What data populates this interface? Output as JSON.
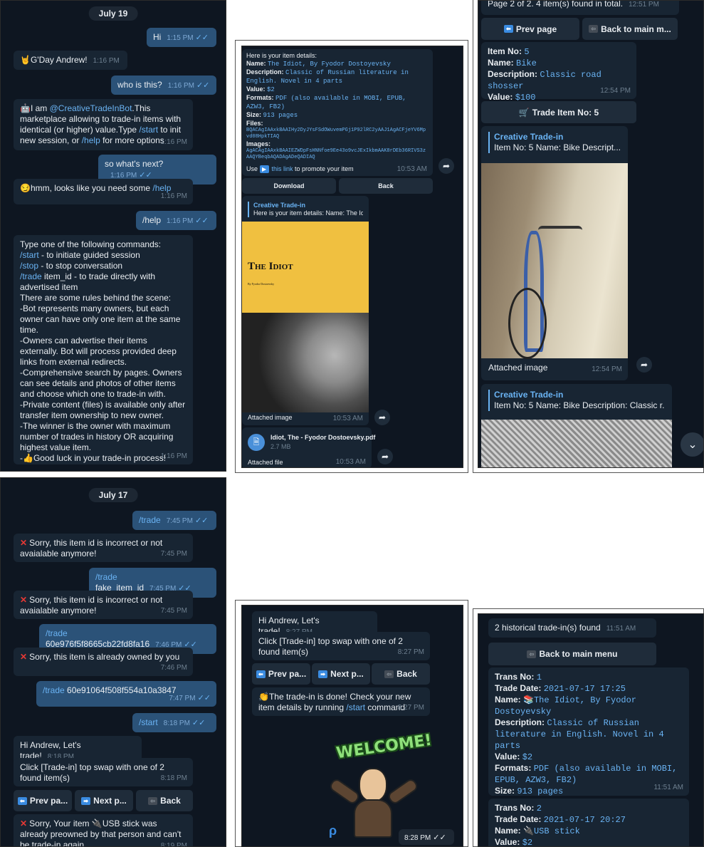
{
  "p1": {
    "date": "July 19",
    "m1": {
      "text": "Hi",
      "time": "1:15 PM"
    },
    "m2": {
      "text": "G'Day Andrew!",
      "time": "1:16 PM"
    },
    "m3": {
      "text": "who is this?",
      "time": "1:16 PM"
    },
    "m4": {
      "a": "I am ",
      "bot": "@CreativeTradeInBot",
      "b": ".This marketplace allowing to trade-in items with identical (or higher) value.Type ",
      "start": "/start",
      "c": " to init new session, or ",
      "help": "/help",
      "d": " for more options",
      "time": "1:16 PM"
    },
    "m5": {
      "text": "so what's next?",
      "time": "1:16 PM"
    },
    "m6": {
      "text": "hmm, looks like you need some ",
      "help": "/help",
      "time": "1:16 PM"
    },
    "m7": {
      "text": "/help",
      "time": "1:16 PM"
    },
    "m8": {
      "intro": "Type one of the following commands:",
      "start": "/start",
      "start_d": " - to initiate guided session",
      "stop": "/stop",
      "stop_d": " - to stop conversation",
      "trade": "/trade",
      "trade_d": " item_id - to trade directly with advertised item",
      "rules": "There are some rules behind the scene:",
      "r1": "-Bot represents many owners, but each owner can have only one item at the same time.",
      "r2": "-Owners can advertise their items externally. Bot will process provided deep links from external redirects.",
      "r3": "-Comprehensive search by pages. Owners can see details and photos of other items and choose which one to trade-in with.",
      "r4": "-Private content (files) is available only after transfer item ownership to new owner.",
      "r5": "-The winner is the owner with maximum number of trades in history OR acquiring highest value item.",
      "r6": "Good luck in your trade-in process!",
      "time": "1:16 PM"
    }
  },
  "p2": {
    "details": {
      "title": "Here is your item details:",
      "name_l": "Name:",
      "name_v": "The Idiot, By Fyodor Dostoyevsky",
      "desc_l": "Description:",
      "desc_v": "Classic of Russian literature in English. Novel in 4 parts",
      "value_l": "Value:",
      "value_v": "$2",
      "formats_l": "Formats:",
      "formats_v": "PDF (also available in MOBI, EPUB, AZW3, FB2)",
      "size_l": "Size:",
      "size_v": "913 pages",
      "files_l": "Files:",
      "files_v": "BQACAgIAAxkBAAIHy2DyJYsFSdOWuvemPGj1P92lRC2yAAJ1AgACFjeYV6Mpvd08HpkTIAQ",
      "images_l": "Images:",
      "images_v": "AgACAgIAAxkBAAIEZWDpFsHNNfoe9Ee43o9vcJExIkbmAAK8rDEb36RIVS3zAAQYBeqbAQADAgADeQADIAQ",
      "use": "Use ",
      "link": "this link",
      "promote": " to promote your item",
      "time": "10:53 AM"
    },
    "btn_download": "Download",
    "btn_back": "Back",
    "fwd": {
      "source": "Creative Trade-in",
      "text": "Here is your item details: Name: The Idio..."
    },
    "book": {
      "title": "The Idiot",
      "author": "By Fyodor Dostoevsky"
    },
    "img_caption": "Attached image",
    "img_time": "10:53 AM",
    "file": {
      "name": "Idiot, The - Fyodor Dostoevsky.pdf",
      "size": "2.7 MB"
    },
    "file_caption": "Attached file",
    "file_time": "10:53 AM"
  },
  "p3": {
    "page_info": "Page 2 of 2. 4 item(s) found in total.",
    "page_time": "12:51 PM",
    "btn_prev": "Prev page",
    "btn_main": "Back to main m...",
    "item": {
      "no_l": "Item No:",
      "no_v": "5",
      "name_l": "Name:",
      "name_v": "Bike",
      "desc_l": "Description:",
      "desc_v": "Classic road shosser",
      "value_l": "Value:",
      "value_v": "$100",
      "time": "12:54 PM"
    },
    "btn_trade": "Trade Item No: 5",
    "fwd1": {
      "source": "Creative Trade-in",
      "text": "Item No: 5 Name: Bike Descript..."
    },
    "img_caption": "Attached image",
    "img_time": "12:54 PM",
    "fwd2": {
      "source": "Creative Trade-in",
      "text": "Item No: 5 Name: Bike Description: Classic r..."
    }
  },
  "p4": {
    "date": "July 17",
    "m1": {
      "text": "/trade",
      "time": "7:45 PM"
    },
    "m2": {
      "text": "Sorry, this item id is incorrect or not avaialable anymore!",
      "time": "7:45 PM"
    },
    "m3": {
      "cmd": "/trade",
      "text": " fake_item_id",
      "time": "7:45 PM"
    },
    "m4": {
      "text": "Sorry, this item id is incorrect or not avaialable anymore!",
      "time": "7:45 PM"
    },
    "m5": {
      "cmd": "/trade",
      "text": " 60e976f5f8665cb22fd8fa16",
      "time": "7:46 PM"
    },
    "m6": {
      "text": "Sorry, this item is already owned by you",
      "time": "7:46 PM"
    },
    "m7": {
      "cmd": "/trade",
      "text": " 60e91064f508f554a10a3847",
      "time": "7:47 PM"
    },
    "m8": {
      "text": "/start",
      "time": "8:18 PM"
    },
    "m9": {
      "text": "Hi Andrew, Let's trade!",
      "time": "8:18 PM"
    },
    "m10": {
      "text": "Click [Trade-in] top swap with one of 2 found item(s)",
      "time": "8:18 PM"
    },
    "btn_prev": "Prev pa...",
    "btn_next": "Next p...",
    "btn_back": "Back",
    "m11": {
      "a": "Sorry, Your item ",
      "b": "USB stick was already preowned by that person and can't be trade-in again",
      "time": "8:19 PM"
    }
  },
  "p5": {
    "m1": {
      "text": "Hi Andrew, Let's trade!",
      "time": "8:27 PM"
    },
    "m2": {
      "text": "Click [Trade-in] top swap with one of 2 found item(s)",
      "time": "8:27 PM"
    },
    "btn_prev": "Prev pa...",
    "btn_next": "Next p...",
    "btn_back": "Back",
    "m3": {
      "a": "The trade-in is done! Check your new item details by running ",
      "start": "/start",
      "b": " command",
      "time": "8:27 PM"
    },
    "sticker_text": "WELCOME!",
    "sticker_time": "8:28 PM"
  },
  "p6": {
    "found": "2 historical trade-in(s) found",
    "found_time": "11:51 AM",
    "btn_main": "Back to main menu",
    "t1": {
      "no_l": "Trans No:",
      "no_v": "1",
      "date_l": "Trade Date:",
      "date_v": "2021-07-17 17:25",
      "name_l": "Name:",
      "name_v": "The Idiot, By Fyodor Dostoyevsky",
      "desc_l": "Description:",
      "desc_v": "Classic of Russian literature in English. Novel in 4 parts",
      "value_l": "Value:",
      "value_v": "$2",
      "formats_l": "Formats:",
      "formats_v": "PDF (also available in MOBI, EPUB, AZW3, FB2)",
      "size_l": "Size:",
      "size_v": "913 pages",
      "time": "11:51 AM"
    },
    "t2": {
      "no_l": "Trans No:",
      "no_v": "2",
      "date_l": "Trade Date:",
      "date_v": "2021-07-17 20:27",
      "name_l": "Name:",
      "name_v": "USB stick",
      "value_l": "Value:",
      "value_v": "$2"
    }
  }
}
